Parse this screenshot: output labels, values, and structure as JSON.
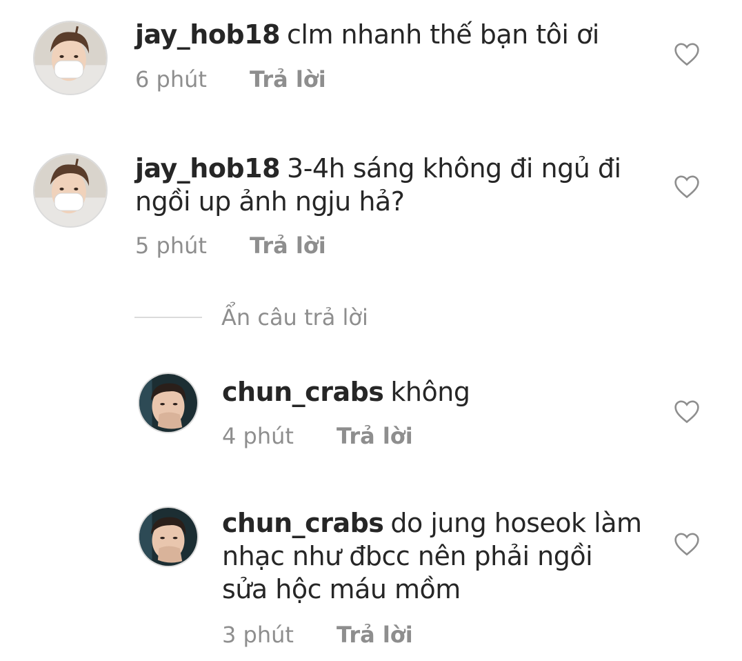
{
  "comments": [
    {
      "username": "jay_hob18",
      "text": "clm nhanh thế bạn tôi ơi",
      "time": "6 phút",
      "reply_label": "Trả lời",
      "avatar_icon": "avatar-masked-person"
    },
    {
      "username": "jay_hob18",
      "text": "3-4h sáng không đi ngủ đi ngồi up ảnh ngju hả?",
      "time": "5 phút",
      "reply_label": "Trả lời",
      "avatar_icon": "avatar-masked-person"
    }
  ],
  "hide_replies_label": "Ẩn câu trả lời",
  "replies": [
    {
      "username": "chun_crabs",
      "text": "không",
      "time": "4 phút",
      "reply_label": "Trả lời",
      "avatar_icon": "avatar-person-hand-on-face"
    },
    {
      "username": "chun_crabs",
      "text": "do jung hoseok làm nhạc như đbcc nên phải ngồi sửa hộc máu mồm",
      "time": "3 phút",
      "reply_label": "Trả lời",
      "avatar_icon": "avatar-person-hand-on-face"
    }
  ],
  "icons": {
    "like": "heart-outline-icon"
  },
  "colors": {
    "text": "#262626",
    "secondary": "#8e8e8e",
    "divider": "#dbdbdb"
  }
}
